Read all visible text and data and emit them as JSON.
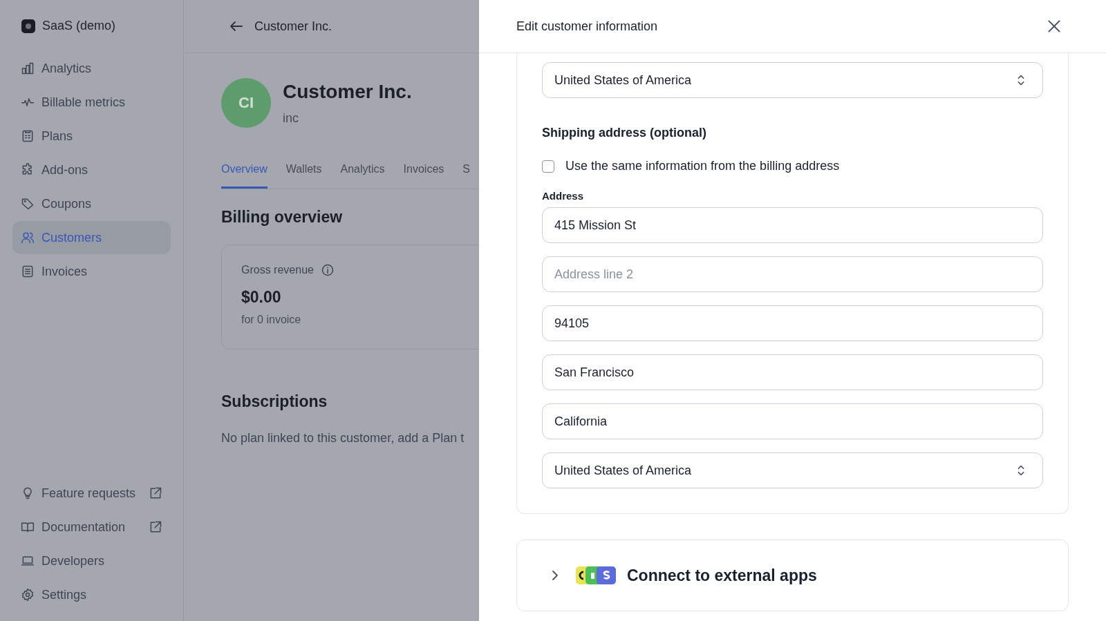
{
  "sidebar": {
    "workspace": "SaaS (demo)",
    "items": [
      {
        "label": "Analytics",
        "selected": false
      },
      {
        "label": "Billable metrics",
        "selected": false
      },
      {
        "label": "Plans",
        "selected": false
      },
      {
        "label": "Add-ons",
        "selected": false
      },
      {
        "label": "Coupons",
        "selected": false
      },
      {
        "label": "Customers",
        "selected": true
      },
      {
        "label": "Invoices",
        "selected": false
      }
    ],
    "footer_items": [
      {
        "label": "Feature requests",
        "external": true
      },
      {
        "label": "Documentation",
        "external": true
      },
      {
        "label": "Developers",
        "external": false
      },
      {
        "label": "Settings",
        "external": false
      }
    ]
  },
  "page": {
    "header_title": "Customer Inc.",
    "avatar_initials": "CI",
    "name": "Customer Inc.",
    "subtitle": "inc",
    "tabs": [
      {
        "label": "Overview",
        "selected": true
      },
      {
        "label": "Wallets",
        "selected": false
      },
      {
        "label": "Analytics",
        "selected": false
      },
      {
        "label": "Invoices",
        "selected": false
      },
      {
        "label": "S",
        "selected": false
      }
    ],
    "billing_heading": "Billing overview",
    "revenue_card": {
      "label": "Gross revenue",
      "amount": "$0.00",
      "caption": "for 0 invoice"
    },
    "subscriptions_heading": "Subscriptions",
    "subscriptions_text": "No plan linked to this customer, add a Plan t"
  },
  "drawer": {
    "title": "Edit customer information",
    "billing_country": {
      "value": "United States of America"
    },
    "shipping_heading": "Shipping address (optional)",
    "same_as_billing": {
      "label": "Use the same information from the billing address",
      "checked": false
    },
    "address_label": "Address",
    "fields": [
      {
        "kind": "input",
        "value": "415 Mission St"
      },
      {
        "kind": "input",
        "placeholder": "Address line 2"
      },
      {
        "kind": "input",
        "value": "94105"
      },
      {
        "kind": "input",
        "value": "San Francisco"
      },
      {
        "kind": "input",
        "value": "California"
      },
      {
        "kind": "select",
        "value": "United States of America"
      }
    ],
    "integrations": {
      "title": "Connect to external apps",
      "expanded": false
    }
  }
}
